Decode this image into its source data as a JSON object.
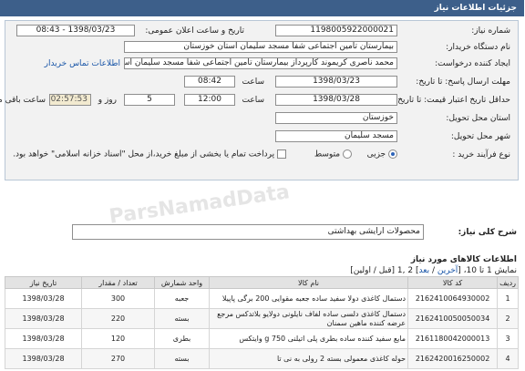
{
  "header": {
    "title": "جزئیات اطلاعات نیاز"
  },
  "fields": {
    "need_number_label": "شماره نیاز:",
    "need_number": "1198005922000021",
    "announce_label": "تاریخ و ساعت اعلان عمومی:",
    "announce_value": "1398/03/23 - 08:43",
    "buyer_label": "نام دستگاه خریدار:",
    "buyer_value": "بیمارستان تامین اجتماعی شفا مسجد سلیمان استان خوزستان",
    "creator_label": "ایجاد کننده درخواست:",
    "creator_value": "محمد ناصری کریموند کارپرداز بیمارستان تامین اجتماعی شفا مسجد سلیمان استان",
    "contact_link": "اطلاعات تماس خریدار",
    "send_deadline_label": "مهلت ارسال پاسخ: تا تاریخ:",
    "send_date": "1398/03/23",
    "time_label1": "ساعت",
    "send_time": "08:42",
    "remaining_days": "5",
    "days_label": "روز و",
    "remaining_time": "02:57:53",
    "remaining_label": "ساعت باقی مانده",
    "price_deadline_label": "حداقل تاریخ اعتبار قیمت: تا تاریخ:",
    "price_date": "1398/03/28",
    "time_label2": "ساعت",
    "price_time": "12:00",
    "province_label": "استان محل تحویل:",
    "province_value": "خوزستان",
    "city_label": "شهر محل تحویل:",
    "city_value": "مسجد سلیمان",
    "process_label": "نوع فرآیند خرید :",
    "opt_partial": "جزیی",
    "opt_medium": "متوسط",
    "payment_note": "پرداخت تمام یا بخشی از مبلغ خرید،از محل \"اسناد خزانه اسلامی\" خواهد بود."
  },
  "description": {
    "label": "شرح کلی نیاز:",
    "value": "محصولات ارایشی بهداشتی"
  },
  "goods": {
    "section_title": "اطلاعات کالاهای مورد نیاز",
    "pager_prefix": "نمایش 1 تا 10، [",
    "pager_end": "آخرین",
    "pager_sep1": "/",
    "pager_next": "بعد",
    "pager_mid": "] 2 ,1 [قبل / اولین]",
    "columns": [
      "ردیف",
      "کد کالا",
      "نام کالا",
      "واحد شمارش",
      "تعداد / مقدار",
      "تاریخ نیاز"
    ],
    "rows": [
      {
        "idx": "1",
        "code": "2162410064930002",
        "name": "دستمال کاغذی دولا سفید ساده جعبه مقوایی 200 برگی پاپیلا",
        "unit": "جعبه",
        "qty": "300",
        "date": "1398/03/28"
      },
      {
        "idx": "2",
        "code": "2162410050050034",
        "name": "دستمال کاغذی دلسی ساده لفاف نایلونی دولایو بلاتدکس مرجع عرضه کننده ماهین سمنان",
        "unit": "بسته",
        "qty": "220",
        "date": "1398/03/28"
      },
      {
        "idx": "3",
        "code": "2161180042000013",
        "name": "مایع سفید کننده ساده بطری پلی اتیلنی 750 g وایتکس",
        "unit": "بطری",
        "qty": "120",
        "date": "1398/03/28"
      },
      {
        "idx": "4",
        "code": "2162420016250002",
        "name": "حوله کاغذی معمولی بسته 2 رولی به نی تا",
        "unit": "بسته",
        "qty": "270",
        "date": "1398/03/28"
      }
    ]
  },
  "watermark": "ParsNamadData"
}
